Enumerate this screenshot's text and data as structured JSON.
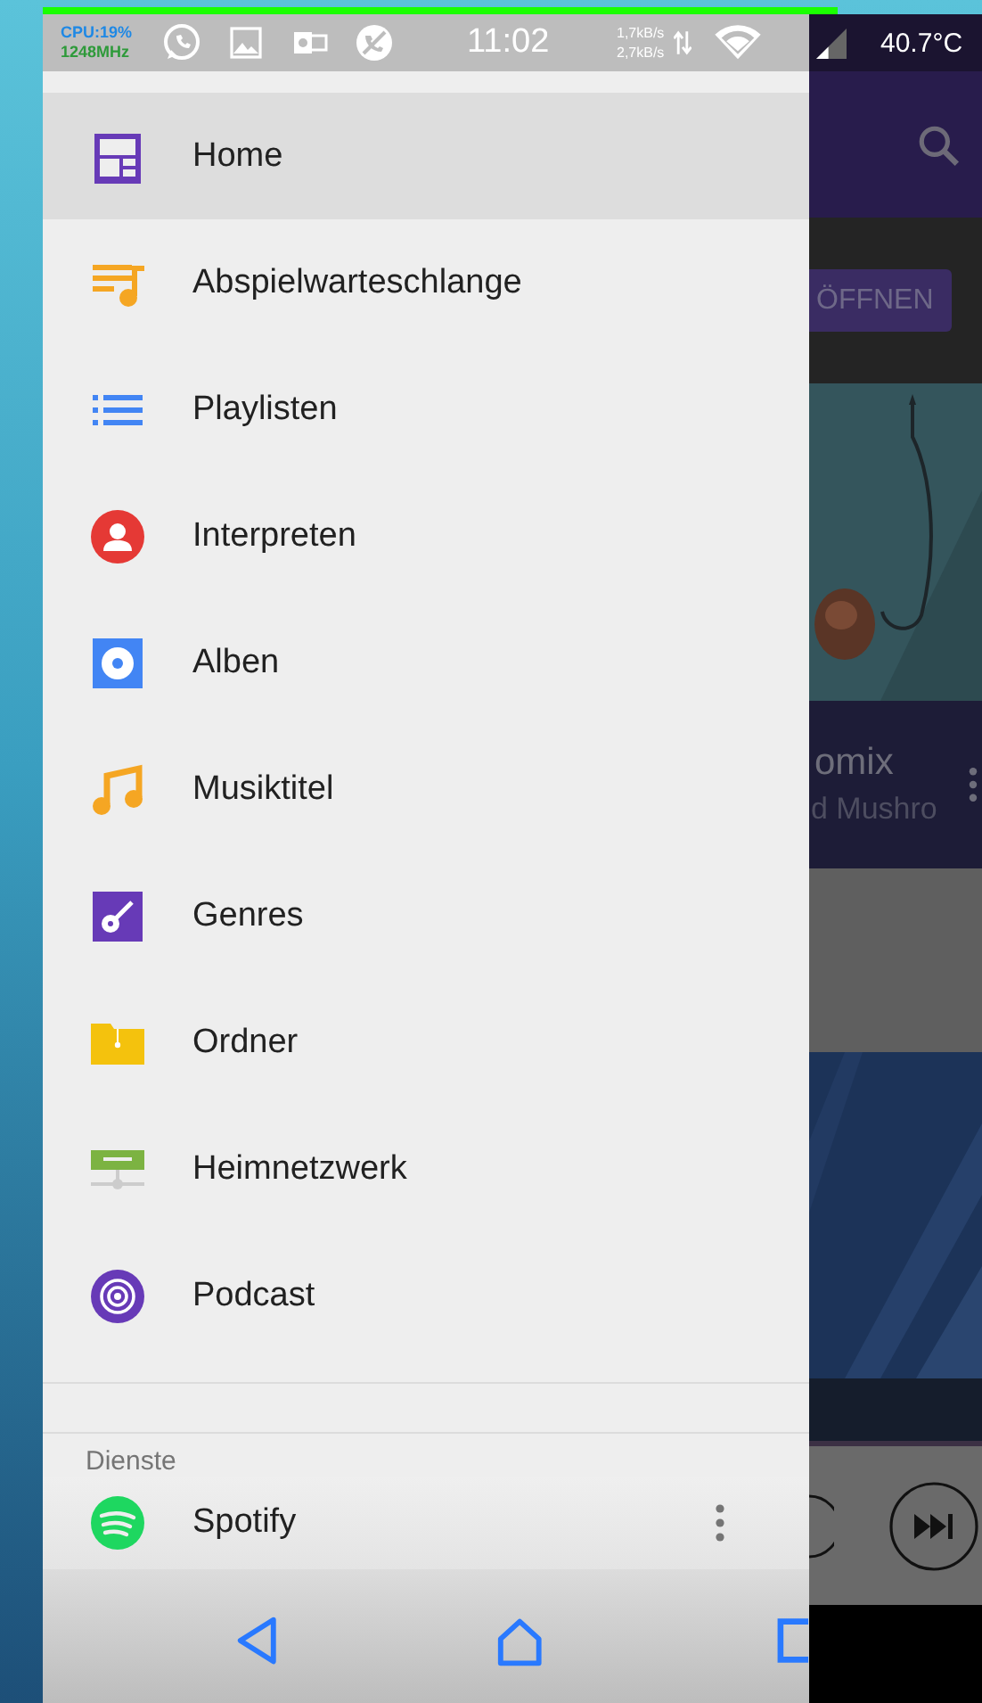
{
  "status_bar": {
    "cpu": "CPU:19%",
    "frequency": "1248MHz",
    "time": "11:02",
    "upload_rate": "1,7kB/s",
    "download_rate": "2,7kB/s",
    "temperature": "40.7°C"
  },
  "drawer": {
    "items": [
      {
        "label": "Home",
        "selected": true
      },
      {
        "label": "Abspielwarteschlange",
        "selected": false
      },
      {
        "label": "Playlisten",
        "selected": false
      },
      {
        "label": "Interpreten",
        "selected": false
      },
      {
        "label": "Alben",
        "selected": false
      },
      {
        "label": "Musiktitel",
        "selected": false
      },
      {
        "label": "Genres",
        "selected": false
      },
      {
        "label": "Ordner",
        "selected": false
      },
      {
        "label": "Heimnetzwerk",
        "selected": false
      },
      {
        "label": "Podcast",
        "selected": false
      }
    ],
    "services": {
      "header": "Dienste",
      "items": [
        {
          "label": "Spotify"
        }
      ]
    }
  },
  "background_app": {
    "button": "ÖFFNEN",
    "title": "omix",
    "subtitle": "d Mushro"
  }
}
